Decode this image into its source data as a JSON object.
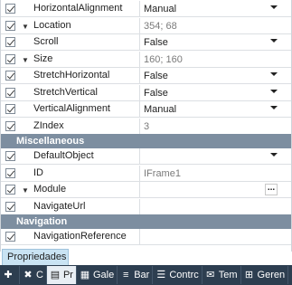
{
  "properties": {
    "rows": [
      {
        "name": "HorizontalAlignment",
        "value": "Manual",
        "expander": false,
        "dropdown": true,
        "ellipsis": false,
        "dim": false
      },
      {
        "name": "Location",
        "value": "354; 68",
        "expander": true,
        "dropdown": false,
        "ellipsis": false,
        "dim": true
      },
      {
        "name": "Scroll",
        "value": "False",
        "expander": false,
        "dropdown": true,
        "ellipsis": false,
        "dim": false
      },
      {
        "name": "Size",
        "value": "160; 160",
        "expander": true,
        "dropdown": false,
        "ellipsis": false,
        "dim": true
      },
      {
        "name": "StretchHorizontal",
        "value": "False",
        "expander": false,
        "dropdown": true,
        "ellipsis": false,
        "dim": false
      },
      {
        "name": "StretchVertical",
        "value": "False",
        "expander": false,
        "dropdown": true,
        "ellipsis": false,
        "dim": false
      },
      {
        "name": "VerticalAlignment",
        "value": "Manual",
        "expander": false,
        "dropdown": true,
        "ellipsis": false,
        "dim": false
      },
      {
        "name": "ZIndex",
        "value": "3",
        "expander": false,
        "dropdown": false,
        "ellipsis": false,
        "dim": true
      }
    ],
    "categories": {
      "miscellaneous": "Miscellaneous",
      "navigation": "Navigation"
    },
    "misc_rows": [
      {
        "name": "DefaultObject",
        "value": "",
        "expander": false,
        "dropdown": true,
        "ellipsis": false,
        "dim": false
      },
      {
        "name": "ID",
        "value": "IFrame1",
        "expander": false,
        "dropdown": false,
        "ellipsis": false,
        "dim": true
      },
      {
        "name": "Module",
        "value": "",
        "expander": true,
        "dropdown": false,
        "ellipsis": true,
        "dim": false
      },
      {
        "name": "NavigateUrl",
        "value": "",
        "expander": false,
        "dropdown": false,
        "ellipsis": false,
        "dim": false
      }
    ],
    "nav_rows": [
      {
        "name": "NavigationReference",
        "value": "",
        "expander": false,
        "dropdown": false,
        "ellipsis": false,
        "dim": false
      }
    ]
  },
  "panel_tab": "Propriedades",
  "tabs": [
    {
      "label": "",
      "icon": "puzzle-icon",
      "glyph": "✚",
      "active": false
    },
    {
      "label": "C",
      "icon": "tools-icon",
      "glyph": "✖",
      "active": false
    },
    {
      "label": "Pr",
      "icon": "properties-icon",
      "glyph": "▤",
      "active": true
    },
    {
      "label": "Gale",
      "icon": "gallery-icon",
      "glyph": "▦",
      "active": false
    },
    {
      "label": "Bar",
      "icon": "database-icon",
      "glyph": "≡",
      "active": false
    },
    {
      "label": "Contrc",
      "icon": "controls-icon",
      "glyph": "☰",
      "active": false
    },
    {
      "label": "Tem",
      "icon": "template-icon",
      "glyph": "✉",
      "active": false
    },
    {
      "label": "Geren",
      "icon": "manager-icon",
      "glyph": "⊞",
      "active": false
    }
  ],
  "colors": {
    "category_bg": "#7d8ea0",
    "tabbar_bg": "#2d3e50",
    "panel_tab_bg": "#c9e3f3"
  }
}
